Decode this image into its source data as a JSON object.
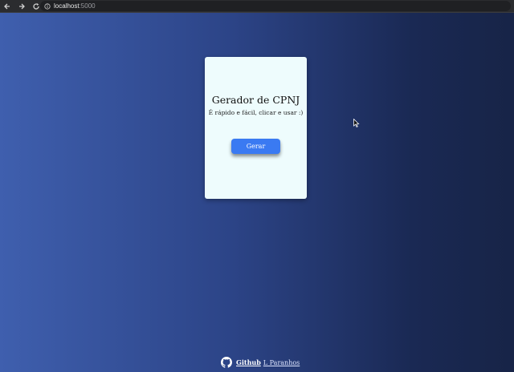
{
  "browser": {
    "url_host": "localhost",
    "url_port": ":5000",
    "back_icon": "arrow-left-icon",
    "forward_icon": "arrow-right-icon",
    "reload_icon": "reload-icon",
    "info_icon": "info-icon"
  },
  "card": {
    "title": "Gerador de CPNJ",
    "subtitle": "É rápido e fácil, clicar e usar :)",
    "button_label": "Gerar"
  },
  "footer": {
    "icon": "github-icon",
    "link_label": "Github",
    "author": "L Paranhos"
  },
  "colors": {
    "background_left": "#3f5fae",
    "background_right": "#172447",
    "card_background": "#eefcfd",
    "button": "#3a7af2"
  }
}
